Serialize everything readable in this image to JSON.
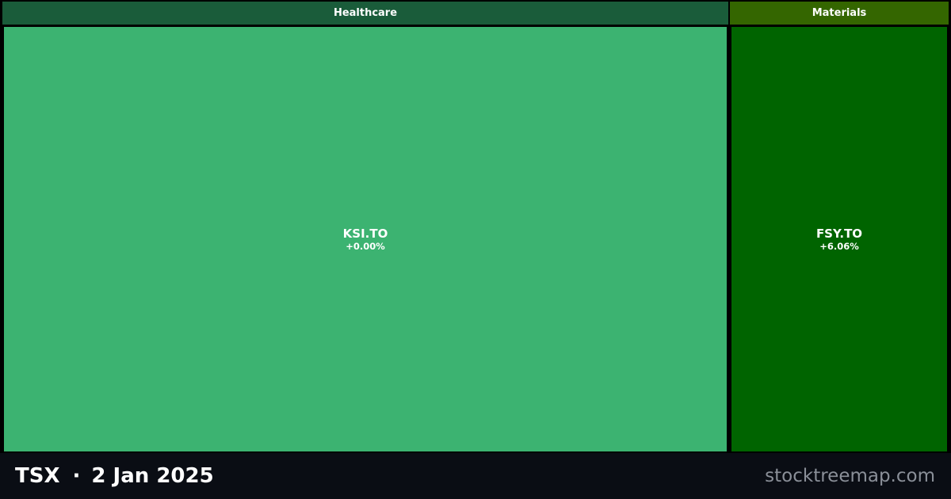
{
  "treemap": {
    "sectors": [
      {
        "name": "Healthcare",
        "header_color": "#1a5c3a",
        "tile": {
          "ticker": "KSI.TO",
          "change": "+0.00%",
          "color": "#3cb371"
        }
      },
      {
        "name": "Materials",
        "header_color": "#346600",
        "tile": {
          "ticker": "FSY.TO",
          "change": "+6.06%",
          "color": "#006400"
        }
      }
    ]
  },
  "footer": {
    "exchange": "TSX",
    "separator": "·",
    "date": "2 Jan 2025",
    "site": "stocktreemap.com"
  }
}
